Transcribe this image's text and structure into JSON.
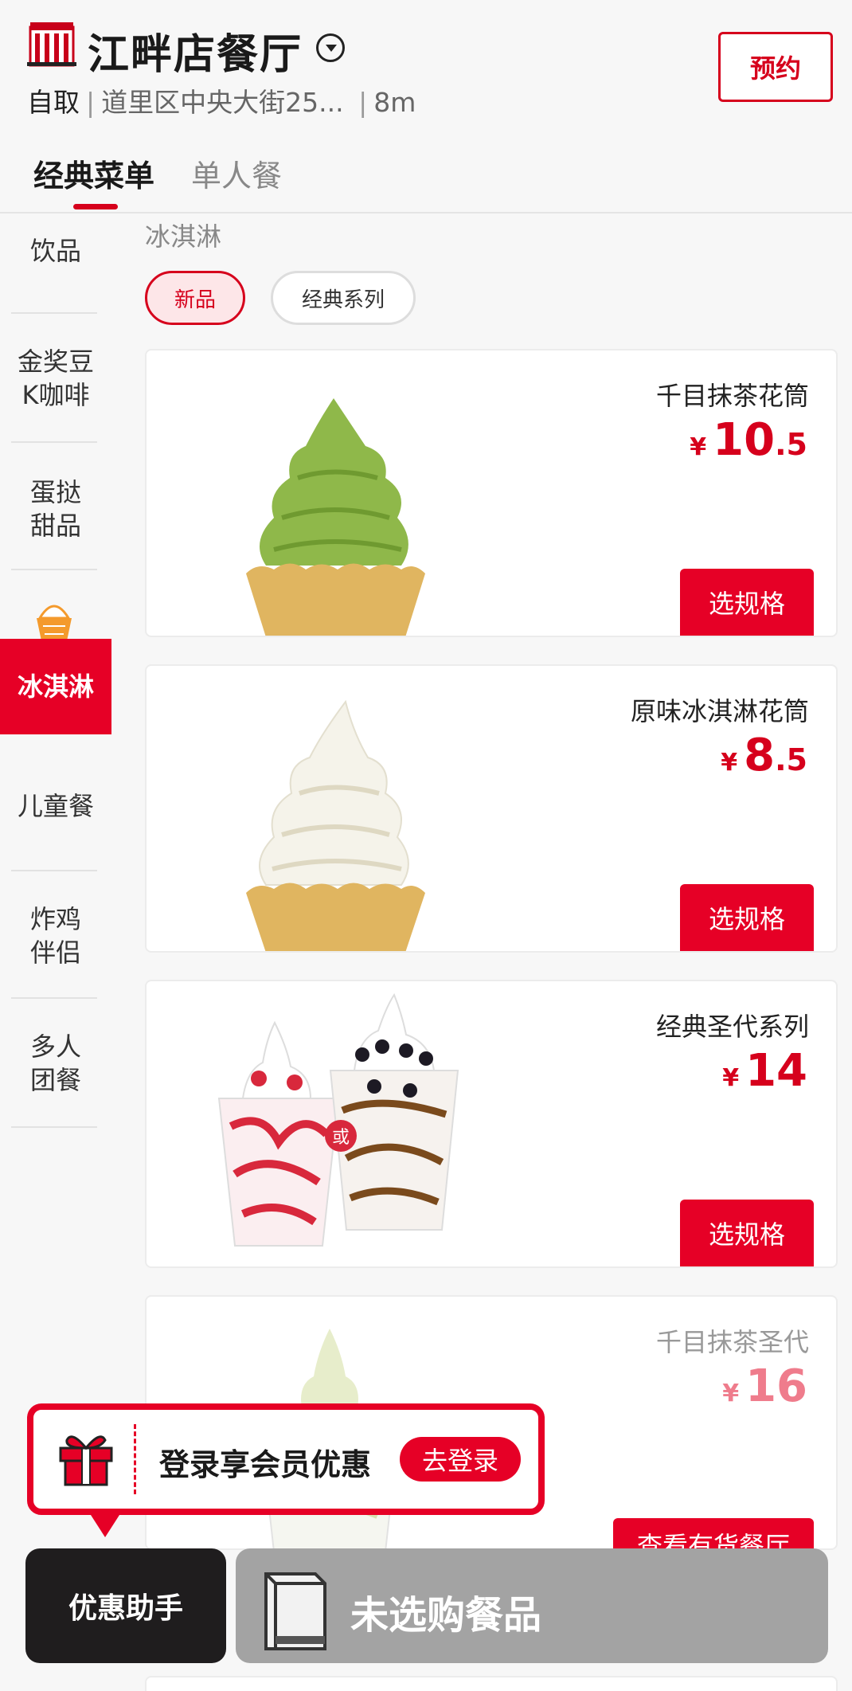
{
  "header": {
    "store_name": "江畔店餐厅",
    "pickup_mode": "自取",
    "address": "道里区中央大街25...",
    "distance": "8m",
    "reserve_label": "预约"
  },
  "tabs": [
    {
      "label": "经典菜单"
    },
    {
      "label": "单人餐"
    }
  ],
  "sidebar": {
    "items": [
      {
        "label": "饮品"
      },
      {
        "label": "金奖豆K咖啡"
      },
      {
        "label": "蛋挞甜品"
      },
      {
        "label": "冰淇淋"
      },
      {
        "label": "儿童餐"
      },
      {
        "label": "炸鸡伴侣"
      },
      {
        "label": "多人团餐"
      }
    ]
  },
  "content": {
    "category_title": "冰淇淋",
    "chips": [
      {
        "label": "新品"
      },
      {
        "label": "经典系列"
      }
    ],
    "products": [
      {
        "name": "千目抹茶花筒",
        "currency": "¥",
        "price_int": "10",
        "price_dec": ".5",
        "action": "选规格"
      },
      {
        "name": "原味冰淇淋花筒",
        "currency": "¥",
        "price_int": "8",
        "price_dec": ".5",
        "action": "选规格"
      },
      {
        "name": "经典圣代系列",
        "currency": "¥",
        "price_int": "14",
        "price_dec": "",
        "action": "选规格",
        "or_label": "或"
      },
      {
        "name": "千目抹茶圣代",
        "currency": "¥",
        "price_int": "16",
        "price_dec": "",
        "action": "查看有货餐厅"
      }
    ]
  },
  "login_banner": {
    "text": "登录享会员优惠",
    "button": "去登录"
  },
  "bottom_bar": {
    "helper": "优惠助手",
    "cart_text": "未选购餐品"
  },
  "colors": {
    "accent": "#e60026",
    "matcha": "#8fb84a",
    "vanilla": "#f5f3ea",
    "cone": "#e0b560"
  }
}
